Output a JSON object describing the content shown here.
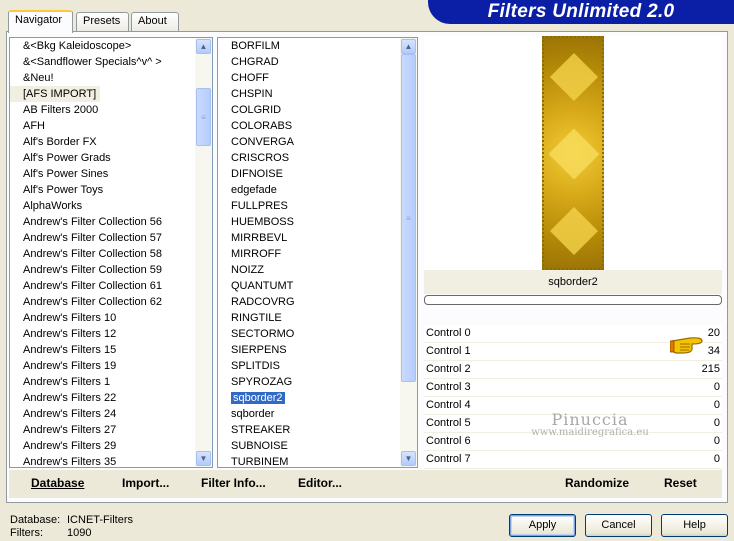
{
  "app": {
    "title": "Filters Unlimited 2.0"
  },
  "tabs": [
    {
      "label": "Navigator"
    },
    {
      "label": "Presets"
    },
    {
      "label": "About"
    }
  ],
  "categories": {
    "items": [
      "&<Bkg Kaleidoscope>",
      "&<Sandflower Specials^v^ >",
      "&Neu!",
      "[AFS IMPORT]",
      "AB Filters 2000",
      "AFH",
      "Alf's Border FX",
      "Alf's Power Grads",
      "Alf's Power Sines",
      "Alf's Power Toys",
      "AlphaWorks",
      "Andrew's Filter Collection 56",
      "Andrew's Filter Collection 57",
      "Andrew's Filter Collection 58",
      "Andrew's Filter Collection 59",
      "Andrew's Filter Collection 61",
      "Andrew's Filter Collection 62",
      "Andrew's Filters 10",
      "Andrew's Filters 12",
      "Andrew's Filters 15",
      "Andrew's Filters 19",
      "Andrew's Filters 1",
      "Andrew's Filters 22",
      "Andrew's Filters 24",
      "Andrew's Filters 27",
      "Andrew's Filters 29",
      "Andrew's Filters 35"
    ],
    "selected": "[AFS IMPORT]"
  },
  "filters": {
    "items": [
      "BORFILM",
      "CHGRAD",
      "CHOFF",
      "CHSPIN",
      "COLGRID",
      "COLORABS",
      "CONVERGA",
      "CRISCROS",
      "DIFNOISE",
      "edgefade",
      "FULLPRES",
      "HUEMBOSS",
      "MIRRBEVL",
      "MIRROFF",
      "NOIZZ",
      "QUANTUMT",
      "RADCOVRG",
      "RINGTILE",
      "SECTORMO",
      "SIERPENS",
      "SPLITDIS",
      "SPYROZAG",
      "sqborder2",
      "sqborder",
      "STREAKER",
      "SUBNOISE",
      "TURBINEM"
    ],
    "selected": "sqborder2"
  },
  "preview": {
    "filter_name": "sqborder2"
  },
  "controls": [
    {
      "label": "Control 0",
      "value": "20"
    },
    {
      "label": "Control 1",
      "value": "34"
    },
    {
      "label": "Control 2",
      "value": "215"
    },
    {
      "label": "Control 3",
      "value": "0"
    },
    {
      "label": "Control 4",
      "value": "0"
    },
    {
      "label": "Control 5",
      "value": "0"
    },
    {
      "label": "Control 6",
      "value": "0"
    },
    {
      "label": "Control 7",
      "value": "0"
    }
  ],
  "watermark": {
    "line1": "Pinuccia",
    "line2": "www.maidiregrafica.eu"
  },
  "panel_buttons": {
    "database": "Database",
    "import": "Import...",
    "filter_info": "Filter Info...",
    "editor": "Editor...",
    "randomize": "Randomize",
    "reset": "Reset"
  },
  "status": {
    "database_label": "Database:",
    "database_value": "ICNET-Filters",
    "filters_label": "Filters:",
    "filters_value": "1090"
  },
  "buttons": {
    "apply": "Apply",
    "cancel": "Cancel",
    "help": "Help"
  },
  "icons": {
    "pointer": "pointing-hand-icon",
    "scroll_up": "arrow-up-icon",
    "scroll_down": "arrow-down-icon"
  },
  "colors": {
    "banner": "#0b1fa6",
    "selection": "#316ac5",
    "preview_gold": "#d8aa1a"
  }
}
